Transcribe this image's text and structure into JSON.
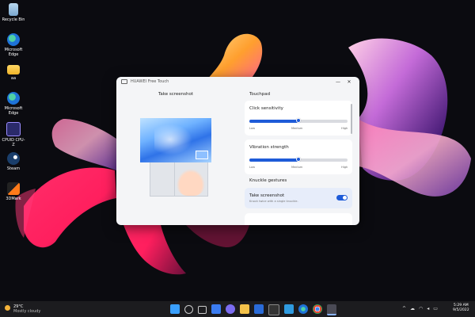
{
  "desktop": {
    "icons": [
      {
        "label": "Recycle Bin",
        "icon": "recycle-bin-icon"
      },
      {
        "label": "Microsoft Edge",
        "icon": "edge-icon"
      },
      {
        "label": "aa",
        "icon": "folder-icon"
      },
      {
        "label": "Microsoft Edge",
        "icon": "edge-icon"
      },
      {
        "label": "CPUID CPU-Z",
        "icon": "cpuz-icon"
      },
      {
        "label": "Steam",
        "icon": "steam-icon"
      },
      {
        "label": "3DMark",
        "icon": "3dmark-icon"
      }
    ]
  },
  "window": {
    "title": "HUAWEI Free Touch",
    "controls": {
      "minimize": "—",
      "close": "✕"
    },
    "left": {
      "heading": "Take screenshot"
    },
    "right": {
      "heading": "Touchpad",
      "click_sensitivity": {
        "label": "Click sensitivity",
        "value": 0.5,
        "low": "Low",
        "medium": "Medium",
        "high": "High"
      },
      "vibration_strength": {
        "label": "Vibration strength",
        "value": 0.5,
        "low": "Low",
        "medium": "Medium",
        "high": "High"
      },
      "knuckle_heading": "Knuckle gestures",
      "take_screenshot": {
        "label": "Take screenshot",
        "sublabel": "Knock twice with a single knuckle.",
        "enabled": true
      }
    }
  },
  "taskbar": {
    "weather": {
      "temp": "29°C",
      "condition": "Mostly cloudy"
    },
    "apps": [
      "windows-start-icon",
      "search-icon",
      "task-view-icon",
      "widgets-icon",
      "chat-icon",
      "file-explorer-icon",
      "store-icon",
      "terminal-icon",
      "settings-icon",
      "edge-icon",
      "chrome-icon",
      "huawei-free-touch-icon"
    ],
    "tray": {
      "chevron": "^",
      "clock_time": "5:29 AM",
      "clock_date": "9/5/2022"
    }
  },
  "colors": {
    "accent": "#1e5bd8",
    "window_bg": "#f4f5f7",
    "taskbar_bg": "#1c1c1f"
  }
}
